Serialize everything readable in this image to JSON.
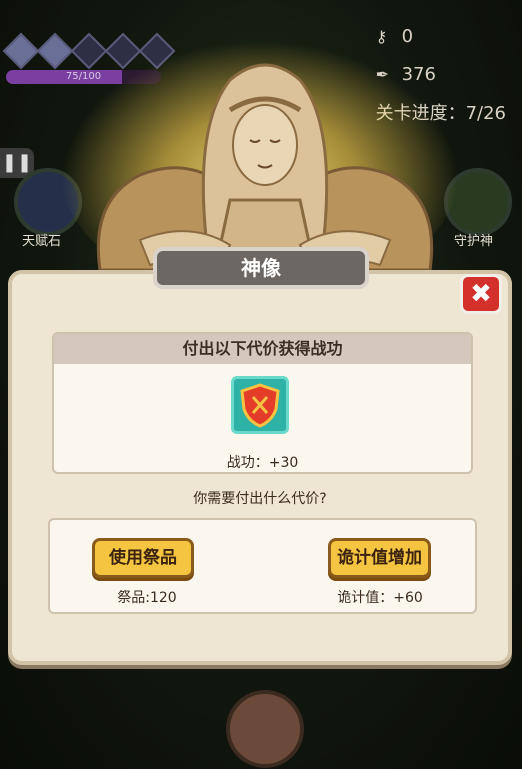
{
  "hud": {
    "xp_text": "75/100",
    "xp_fraction": 0.75,
    "keys": "0",
    "feathers": "376",
    "progress_label": "关卡进度：7/26"
  },
  "side": {
    "left_label": "天赋石",
    "right_label": "守护神"
  },
  "dialog": {
    "title": "神像",
    "card_header": "付出以下代价获得战功",
    "reward_text": "战功：+30",
    "question": "你需要付出什么代价?",
    "option_left": {
      "button": "使用祭品",
      "cost": "祭品:120"
    },
    "option_right": {
      "button": "诡计值增加",
      "cost": "诡计值：+60"
    }
  }
}
